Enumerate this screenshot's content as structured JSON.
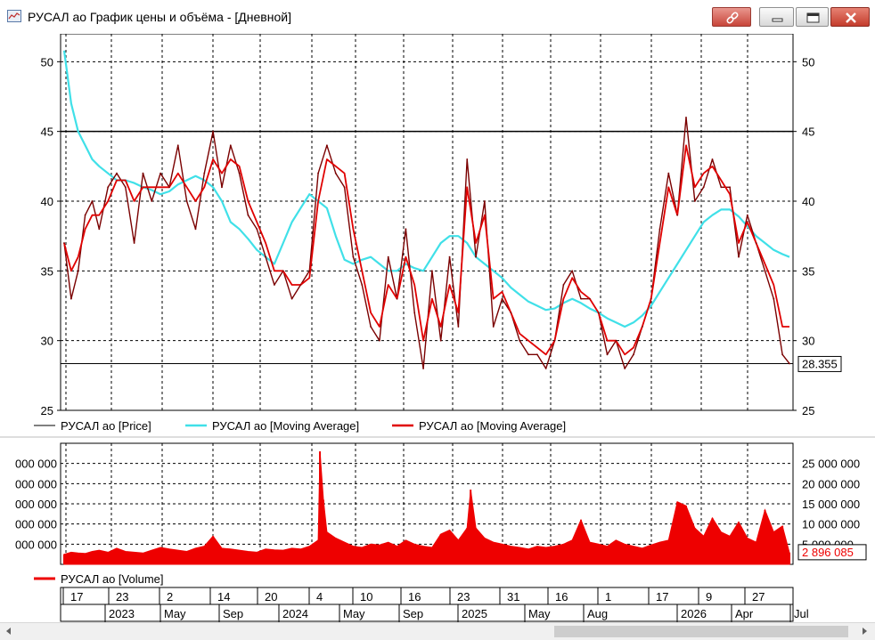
{
  "window": {
    "title": "РУСАЛ ао График цены и объёма - [Дневной]",
    "icons": [
      "chart-window-icon",
      "link-icon",
      "minimize-icon",
      "maximize-icon",
      "close-icon"
    ]
  },
  "colors": {
    "price": "#7a0000",
    "ma_long": "#40e0e8",
    "ma_short": "#e00000",
    "volume": "#ee0000",
    "grid": "#000000",
    "hline": "#000000"
  },
  "chart_data": [
    {
      "type": "line",
      "title": "",
      "ylim": [
        25,
        52
      ],
      "y_ticks": [
        "25",
        "30",
        "35",
        "40",
        "45",
        "50"
      ],
      "y_tick_values": [
        25,
        30,
        35,
        40,
        45,
        50
      ],
      "grid": true,
      "horizontal_lines": [
        45,
        28.355
      ],
      "last_value_label": "28.355",
      "legend_position": "bottom",
      "series": [
        {
          "name": "РУСАЛ ао [Price]",
          "style": "price",
          "x": [
            0,
            4,
            8,
            12,
            16,
            20,
            25,
            30,
            35,
            40,
            45,
            50,
            55,
            60,
            65,
            70,
            75,
            80,
            85,
            90,
            95,
            100,
            105,
            110,
            115,
            120,
            125,
            130,
            135,
            140,
            145,
            150,
            155,
            160,
            165,
            170,
            175,
            180,
            185,
            190,
            195,
            200,
            205,
            210,
            215,
            220,
            225,
            230,
            235,
            240,
            245,
            250,
            255,
            260,
            265,
            270,
            275,
            280,
            285,
            290,
            295,
            300,
            305,
            310,
            315,
            320,
            325,
            330,
            335,
            340,
            345,
            350,
            355,
            360,
            365,
            370,
            375,
            380,
            385,
            390,
            395,
            400,
            405,
            410,
            414
          ],
          "values": [
            37,
            33,
            35,
            39,
            40,
            38,
            41,
            42,
            41,
            37,
            42,
            40,
            42,
            41,
            44,
            40,
            38,
            42,
            45,
            41,
            44,
            42,
            39,
            38,
            36,
            34,
            35,
            33,
            34,
            35,
            42,
            44,
            42,
            41,
            36,
            34,
            31,
            30,
            36,
            33,
            38,
            32,
            28,
            35,
            30,
            36,
            31,
            43,
            36,
            40,
            31,
            33,
            32,
            30,
            29,
            29,
            28,
            30,
            34,
            35,
            33,
            33,
            32,
            29,
            30,
            28,
            29,
            31,
            33,
            38,
            42,
            39,
            46,
            40,
            41,
            43,
            41,
            41,
            36,
            39,
            37,
            35,
            33,
            29,
            28.355
          ]
        },
        {
          "name": "РУСАЛ ао [Moving Average]",
          "style": "ma_long",
          "x": [
            0,
            4,
            8,
            12,
            16,
            20,
            25,
            30,
            35,
            40,
            45,
            50,
            55,
            60,
            65,
            70,
            75,
            80,
            85,
            90,
            95,
            100,
            105,
            110,
            115,
            120,
            125,
            130,
            135,
            140,
            145,
            150,
            155,
            160,
            165,
            170,
            175,
            180,
            185,
            190,
            195,
            200,
            205,
            210,
            215,
            220,
            225,
            230,
            235,
            240,
            245,
            250,
            255,
            260,
            265,
            270,
            275,
            280,
            285,
            290,
            295,
            300,
            305,
            310,
            315,
            320,
            325,
            330,
            335,
            340,
            345,
            350,
            355,
            360,
            365,
            370,
            375,
            380,
            385,
            390,
            395,
            400,
            405,
            410,
            414
          ],
          "values": [
            50.8,
            47,
            45,
            44,
            43,
            42.5,
            42,
            41.5,
            41.5,
            41.3,
            41,
            40.8,
            40.5,
            40.7,
            41.2,
            41.5,
            41.8,
            41.5,
            41,
            40,
            38.5,
            38,
            37.3,
            36.5,
            36,
            35.5,
            37,
            38.5,
            39.5,
            40.5,
            40,
            39.5,
            37.5,
            35.8,
            35.5,
            35.8,
            36,
            35.5,
            35,
            35,
            35.5,
            35.2,
            35,
            36,
            37,
            37.5,
            37.5,
            37,
            36,
            35.5,
            35,
            34.5,
            33.8,
            33.3,
            32.8,
            32.5,
            32.2,
            32.3,
            32.7,
            33,
            32.7,
            32.3,
            32,
            31.6,
            31.3,
            31,
            31.3,
            31.8,
            32.5,
            33.5,
            34.5,
            35.5,
            36.5,
            37.5,
            38.5,
            39,
            39.4,
            39.4,
            38.9,
            38.2,
            37.5,
            37,
            36.5,
            36.2,
            36
          ]
        },
        {
          "name": "РУСАЛ ао [Moving Average]",
          "style": "ma_short",
          "x": [
            0,
            4,
            8,
            12,
            16,
            20,
            25,
            30,
            35,
            40,
            45,
            50,
            55,
            60,
            65,
            70,
            75,
            80,
            85,
            90,
            95,
            100,
            105,
            110,
            115,
            120,
            125,
            130,
            135,
            140,
            145,
            150,
            155,
            160,
            165,
            170,
            175,
            180,
            185,
            190,
            195,
            200,
            205,
            210,
            215,
            220,
            225,
            230,
            235,
            240,
            245,
            250,
            255,
            260,
            265,
            270,
            275,
            280,
            285,
            290,
            295,
            300,
            305,
            310,
            315,
            320,
            325,
            330,
            335,
            340,
            345,
            350,
            355,
            360,
            365,
            370,
            375,
            380,
            385,
            390,
            395,
            400,
            405,
            410,
            414
          ],
          "values": [
            37,
            35,
            36,
            38,
            39,
            39,
            40,
            41.5,
            41.5,
            40,
            41,
            41,
            41,
            41,
            42,
            41,
            40,
            41,
            43,
            42,
            43,
            42.5,
            40,
            38.5,
            37,
            35,
            35,
            34,
            34,
            34.5,
            40,
            43,
            42.5,
            42,
            38,
            35,
            32,
            31,
            34,
            33,
            36,
            34,
            30,
            33,
            31,
            34,
            32,
            41,
            37,
            39,
            33,
            33.5,
            32,
            30.5,
            30,
            29.5,
            29,
            30,
            33,
            34.5,
            33.5,
            33,
            32,
            30,
            30,
            29,
            29.5,
            31,
            33,
            37,
            41,
            39,
            44,
            41,
            42,
            42.5,
            41.5,
            40.5,
            37,
            38.5,
            37,
            35.5,
            34,
            31,
            31
          ]
        }
      ]
    },
    {
      "type": "bar",
      "title": "",
      "ylim": [
        0,
        30000000
      ],
      "y_ticks": [
        "5 000 000",
        "10 000 000",
        "15 000 000",
        "20 000 000",
        "25 000 000"
      ],
      "y_tick_values": [
        5000000,
        10000000,
        15000000,
        20000000,
        25000000
      ],
      "left_ticks_clipped": [
        "000 000",
        "000 000",
        "000 000",
        "000 000",
        "000 000"
      ],
      "last_value_label": "2 896 085",
      "legend_position": "bottom",
      "series": [
        {
          "name": "РУСАЛ ао [Volume]",
          "style": "volume",
          "x": [
            0,
            4,
            8,
            12,
            16,
            20,
            25,
            30,
            35,
            40,
            45,
            50,
            55,
            60,
            65,
            70,
            75,
            80,
            85,
            90,
            95,
            100,
            105,
            110,
            115,
            120,
            125,
            130,
            135,
            140,
            145,
            146,
            148,
            150,
            155,
            160,
            165,
            170,
            175,
            180,
            185,
            190,
            195,
            200,
            205,
            210,
            215,
            220,
            225,
            230,
            232,
            235,
            240,
            245,
            250,
            255,
            260,
            265,
            270,
            275,
            280,
            285,
            290,
            295,
            300,
            305,
            310,
            315,
            320,
            325,
            330,
            335,
            340,
            345,
            350,
            355,
            360,
            365,
            370,
            375,
            380,
            385,
            390,
            395,
            400,
            405,
            410,
            414
          ],
          "values": [
            2500000,
            3000000,
            2800000,
            2700000,
            3200000,
            3500000,
            3000000,
            4000000,
            3200000,
            3000000,
            2800000,
            3500000,
            4200000,
            3800000,
            3500000,
            3200000,
            4000000,
            4500000,
            7000000,
            4000000,
            3800000,
            3500000,
            3200000,
            3000000,
            3800000,
            3600000,
            3500000,
            4000000,
            3800000,
            4500000,
            6000000,
            28000000,
            16000000,
            8000000,
            6500000,
            5500000,
            4500000,
            4200000,
            5000000,
            4800000,
            5500000,
            4500000,
            6000000,
            5000000,
            4500000,
            4200000,
            7500000,
            8500000,
            6000000,
            9000000,
            18500000,
            9000000,
            6500000,
            5500000,
            5000000,
            4500000,
            4200000,
            3800000,
            4500000,
            4200000,
            4500000,
            5000000,
            6000000,
            11000000,
            5500000,
            5000000,
            4500000,
            6000000,
            5000000,
            4500000,
            4000000,
            4800000,
            5500000,
            6000000,
            15500000,
            14500000,
            9000000,
            7000000,
            11500000,
            8000000,
            7000000,
            10500000,
            6500000,
            5500000,
            13500000,
            8000000,
            9500000,
            2896085
          ]
        }
      ]
    }
  ],
  "time_axis": {
    "day_labels": [
      "17",
      "23",
      "2",
      "14",
      "20",
      "4",
      "10",
      "16",
      "23",
      "31",
      "16",
      "1",
      "17",
      "9",
      "27"
    ],
    "period_labels": [
      "2023",
      "May",
      "Sep",
      "2024",
      "May",
      "Sep",
      "2025",
      "May",
      "Aug",
      "2026",
      "Apr",
      "Jul"
    ]
  },
  "scrollbar": {
    "icons": [
      "scroll-left-icon",
      "scroll-right-icon"
    ]
  }
}
